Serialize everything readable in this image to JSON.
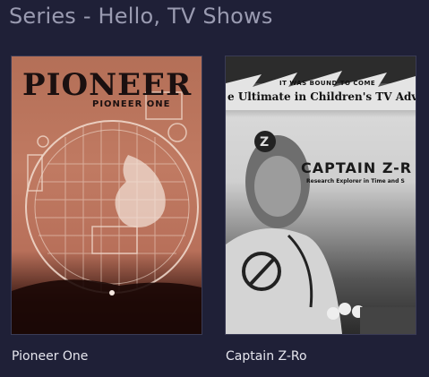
{
  "header": {
    "title": "Series - Hello, TV Shows"
  },
  "shows": [
    {
      "title": "Pioneer One",
      "poster": {
        "logo_text": "PIONEER",
        "subtitle": "PIONEER ONE"
      }
    },
    {
      "title": "Captain Z-Ro",
      "poster": {
        "top_text": "IT WAS BOUND TO COME",
        "tagline": "e Ultimate in Children's TV Adventu",
        "title_text": "CAPTAIN Z-R",
        "subtitle": "Research Explorer in Time and S"
      }
    }
  ],
  "colors": {
    "background": "#1f2037",
    "title_text": "#9a9bb1",
    "card_text": "#e6e6ee"
  }
}
